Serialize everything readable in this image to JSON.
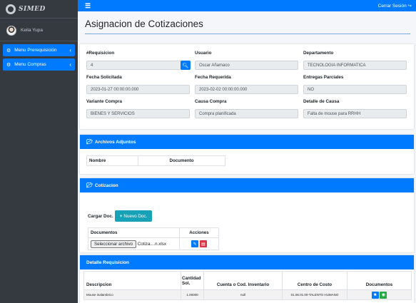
{
  "brand": {
    "name": "SIMED"
  },
  "user": {
    "name": "Keila Yupa"
  },
  "sidebar": {
    "items": [
      {
        "label": "Menu Prerequisición",
        "icon": "gears-icon"
      },
      {
        "label": "Menu Compras",
        "icon": "gears-icon"
      }
    ]
  },
  "topbar": {
    "menu_icon": "☰",
    "logout": "Cerrar Sesión"
  },
  "page": {
    "title": "Asignacion de Cotizaciones"
  },
  "form": {
    "requisicion_label": "#Requisicion",
    "requisicion_value": "4",
    "usuario_label": "Usuario",
    "usuario_value": "Oscar Añamaco",
    "departamento_label": "Departamento",
    "departamento_value": "TECNOLOGIA INFORMATICA",
    "fecha_solicitada_label": "Fecha Solicitada",
    "fecha_solicitada_value": "2023-01-27 00:00:00.000",
    "fecha_requerida_label": "Fecha Requerida",
    "fecha_requerida_value": "2023-02-02 00:00:00.000",
    "entregas_label": "Entregas Parciales",
    "entregas_value": "NO",
    "variante_label": "Variante Compra",
    "variante_value": "BIENES Y SERVICIOS",
    "causa_label": "Causa Compra",
    "causa_value": "Compra planificada",
    "detalle_label": "Detalle de Causa",
    "detalle_value": "Falta de mouse para RRHH"
  },
  "adjuntos": {
    "title": "Archivos Adjuntos",
    "columns": [
      "Nombre",
      "Documento"
    ]
  },
  "cotizacion": {
    "title": "Cotizacion",
    "cargar_label": "Cargar Doc.",
    "nuevo_button": "Nuevo Doc.",
    "columns": [
      "Documentos",
      "Acciones"
    ],
    "file_button": "Seleccionar archivo",
    "file_name": "Cotiza....n.xlsx"
  },
  "detalle": {
    "title": "Detalle Requisicion",
    "columns": [
      "Descripcion",
      "Cantidad Sol.",
      "Cuenta o Cod. Inventario",
      "Centro de Costo",
      "Documentos"
    ],
    "rows": [
      {
        "descripcion": "Mouse inalambrico",
        "cantidad": "1.00000",
        "cuenta": "null",
        "centro": "01.06.01.00-TALENTO HUMANO"
      }
    ]
  },
  "colors": {
    "primary": "#007bff",
    "sidebar": "#343a40",
    "teal": "#17a2b8",
    "danger": "#dc3545",
    "success": "#28a745"
  }
}
